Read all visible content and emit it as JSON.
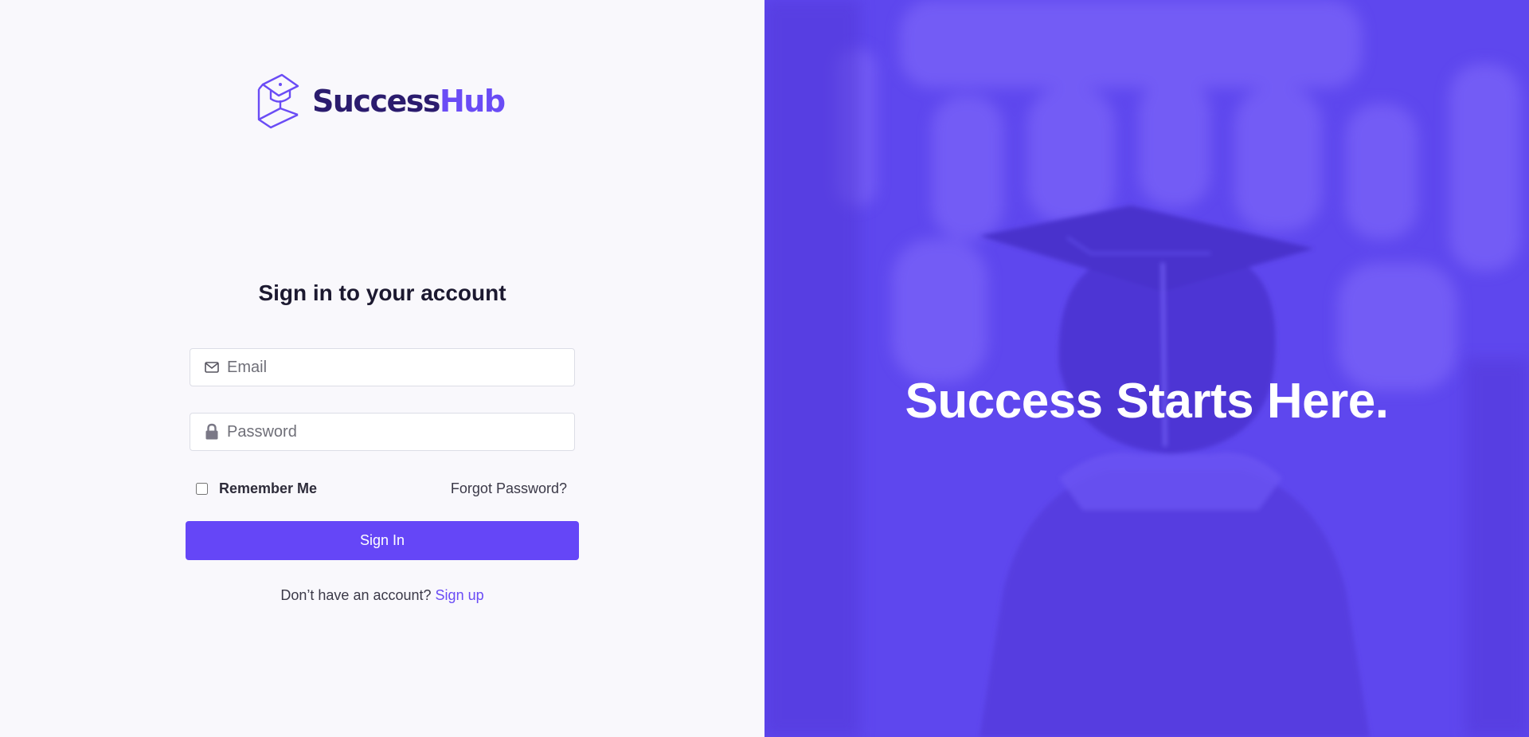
{
  "brand": {
    "name_part1": "Success",
    "name_part2": "Hub",
    "colors": {
      "dark": "#2b1c6e",
      "accent": "#6a4cf5",
      "button": "#6546f7",
      "panel": "#5e47ee"
    }
  },
  "form": {
    "title": "Sign in to your account",
    "email": {
      "placeholder": "Email",
      "value": "",
      "icon": "mail-icon"
    },
    "password": {
      "placeholder": "Password",
      "value": "",
      "icon": "lock-icon"
    },
    "remember_label": "Remember Me",
    "remember_checked": false,
    "forgot_label": "Forgot Password?",
    "submit_label": "Sign In",
    "signup_prompt": "Don’t have an account?",
    "signup_link": "Sign up"
  },
  "hero": {
    "tagline": "Success Starts Here.",
    "image": "graduate-photo"
  }
}
